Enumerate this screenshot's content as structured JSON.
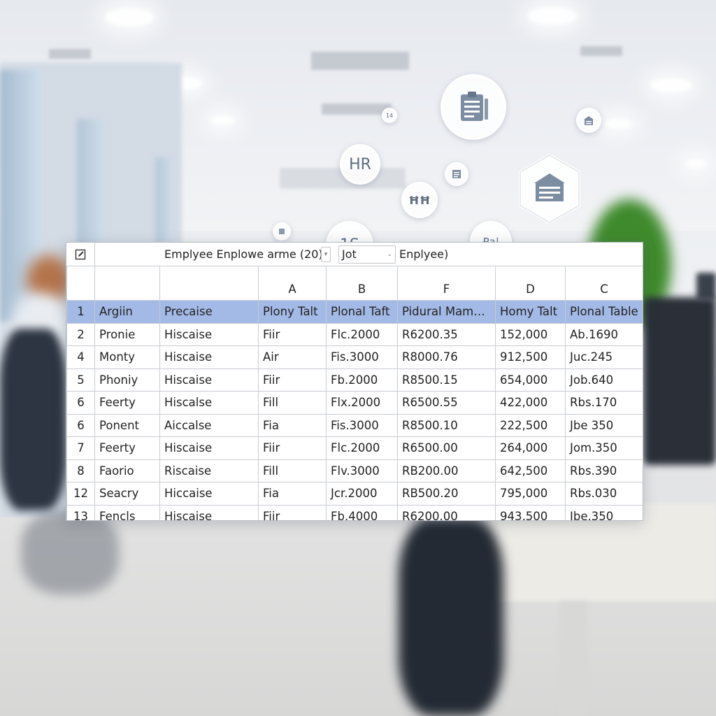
{
  "toolbar": {
    "title": "Emplyee Enplowe arme",
    "count": "(20)",
    "select_value": "Jot",
    "label": "Enplyee)",
    "icons": {
      "corner": "edit-icon",
      "spin": "spinner-arrow-icon",
      "dropdown": "chevron-down-icon"
    }
  },
  "floating_icons": {
    "hr": "HR",
    "badge_small_1": "14",
    "badge_chart": "1S",
    "badge_book": "ĦĦ",
    "badge_person": "₽a|",
    "icon_names": [
      "clipboard-icon",
      "document-icon",
      "building-icon",
      "ledger-icon",
      "chart-icon",
      "people-icon"
    ]
  },
  "grid": {
    "column_letters": [
      "",
      "",
      "",
      "A",
      "B",
      "F",
      "D",
      "C"
    ],
    "header_row": {
      "num": "1",
      "cells": [
        "Argiin",
        "Precaise",
        "Plony Talt",
        "Plonal Taft",
        "Pidural Mame...",
        "Homy Talt",
        "Plonal Table"
      ]
    },
    "rows": [
      {
        "num": "2",
        "cells": [
          "Pronie",
          "Hiscaise",
          "Fiir",
          "Flc.2000",
          "R6200.35",
          "152,000",
          "Ab.1690"
        ]
      },
      {
        "num": "4",
        "cells": [
          "Monty",
          "Hiscaise",
          "Air",
          "Fis.3000",
          "R8000.76",
          "912,500",
          "Juc.245"
        ]
      },
      {
        "num": "5",
        "cells": [
          "Phoniy",
          "Hiscaise",
          "Fiir",
          "Fb.2000",
          "R8500.15",
          "654,000",
          "Job.640"
        ]
      },
      {
        "num": "6",
        "cells": [
          "Feerty",
          "Hiscalse",
          "Fill",
          "Flx.2000",
          "R6500.55",
          "422,000",
          "Rbs.170"
        ]
      },
      {
        "num": "6",
        "cells": [
          "Ponent",
          "Aiccalse",
          "Fia",
          "Fis.3000",
          "R8500.10",
          "222,500",
          "Jbe 350"
        ]
      },
      {
        "num": "7",
        "cells": [
          "Feerty",
          "Hiscaise",
          "Fiir",
          "Flc.2000",
          "R6500.00",
          "264,000",
          "Jom.350"
        ]
      },
      {
        "num": "8",
        "cells": [
          "Faorio",
          "Riscaise",
          "Fill",
          "Flv.3000",
          "RB200.00",
          "642,500",
          "Rbs.390"
        ]
      },
      {
        "num": "12",
        "cells": [
          "Seacry",
          "Hiccaise",
          "Fia",
          "Jcr.2000",
          "RB500.20",
          "795,000",
          "Rbs.030"
        ]
      },
      {
        "num": "13",
        "cells": [
          "Fencls",
          "Hiscaise",
          "Fiir",
          "Fb.4000",
          "R6200.00",
          "943,500",
          "Jbe.350"
        ]
      }
    ]
  },
  "colors": {
    "header_fill": "#a3b9e6",
    "grid_line": "#c9ccd1"
  }
}
